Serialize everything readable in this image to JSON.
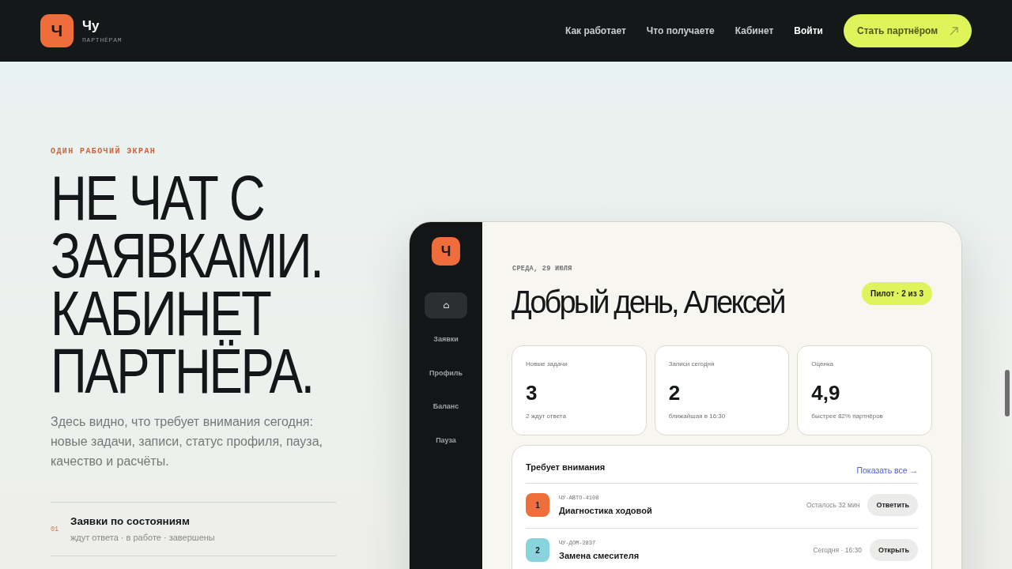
{
  "header": {
    "logo_mark": "Ч",
    "brand": "Чу",
    "tagline": "ПАРТНЁРАМ",
    "nav": [
      "Как работает",
      "Что получаете",
      "Кабинет"
    ],
    "login": "Войти",
    "cta": "Стать партнёром"
  },
  "hero": {
    "eyebrow": "ОДИН РАБОЧИЙ ЭКРАН",
    "title": "НЕ ЧАТ С ЗАЯВКАМИ. КАБИНЕТ ПАРТНЁРА.",
    "lead": "Здесь видно, что требует внимания сегодня: новые задачи, записи, статус профиля, пауза, качество и расчёты.",
    "features": [
      {
        "number": "01",
        "title": "Заявки по состояниям",
        "subtitle": "ждут ответа · в работе · завершены"
      }
    ]
  },
  "dashboard": {
    "logo_mark": "Ч",
    "sidebar": [
      {
        "kind": "icon",
        "selected": true
      },
      {
        "kind": "label",
        "label": "Заявки",
        "selected": false
      },
      {
        "kind": "label",
        "label": "Профиль",
        "selected": false
      },
      {
        "kind": "label",
        "label": "Баланс",
        "selected": false
      },
      {
        "kind": "label",
        "label": "Пауза",
        "selected": false
      }
    ],
    "date": "СРЕДА, 29 ИЮЛЯ",
    "greeting": "Добрый день, Алексей",
    "badge": "Пилот · 2 из 3",
    "stats": [
      {
        "label": "Новые задачи",
        "value": "3",
        "note": "2 ждут ответа"
      },
      {
        "label": "Записи сегодня",
        "value": "2",
        "note": "ближайшая в 16:30"
      },
      {
        "label": "Оценка",
        "value": "4,9",
        "note": "быстрее 82% партнёров"
      }
    ],
    "attention": {
      "title": "Требует внимания",
      "link": "Показать все →",
      "rows": [
        {
          "number": "1",
          "color": "#ee6e3c",
          "code": "ЧУ-АВТО-4108",
          "title": "Диагностика ходовой",
          "meta": "Осталось 32 мин",
          "action": "Ответить"
        },
        {
          "number": "2",
          "color": "#88d3dc",
          "code": "ЧУ-ДОМ-2837",
          "title": "Замена смесителя",
          "meta": "Сегодня · 16:30",
          "action": "Открыть"
        }
      ]
    }
  }
}
